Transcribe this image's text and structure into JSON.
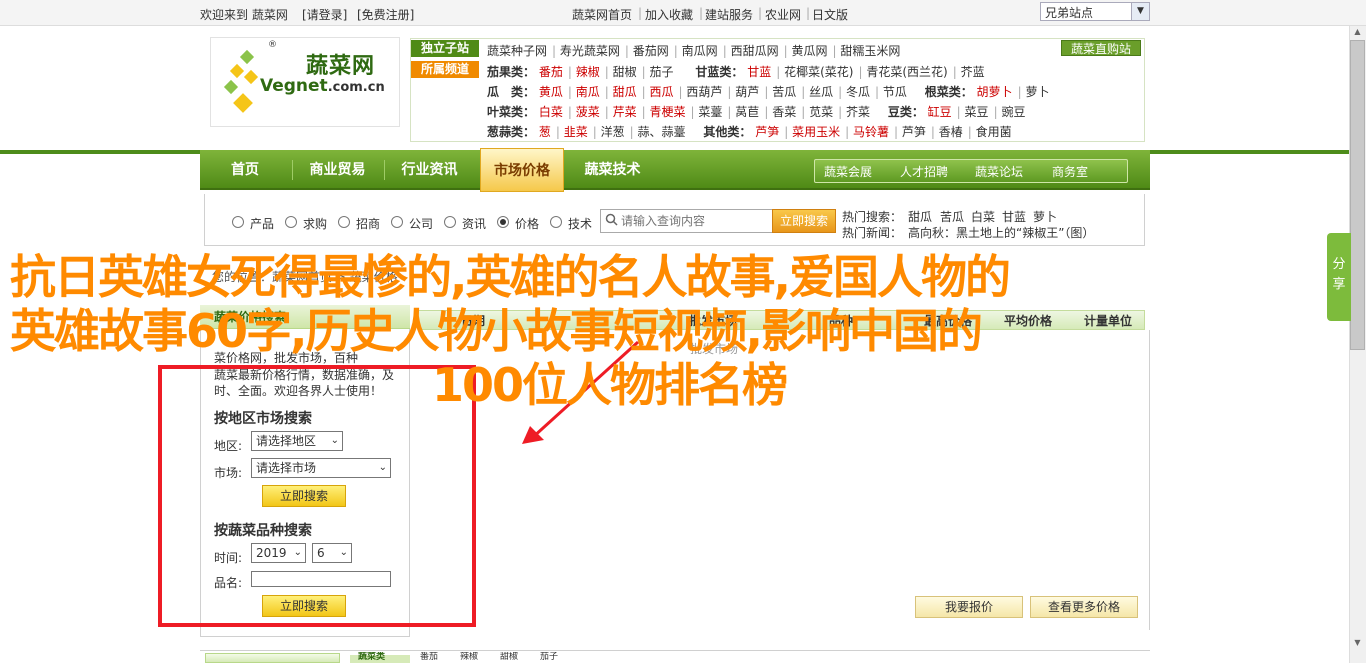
{
  "topbar": {
    "welcome": "欢迎来到 蔬菜网",
    "login": "[请登录]",
    "register": "[免费注册]",
    "links": [
      "蔬菜网首页",
      "加入收藏",
      "建站服务",
      "农业网",
      "日文版"
    ],
    "site_select": "兄弟站点"
  },
  "logo": {
    "cn": "蔬菜网",
    "en_a": "Vegnet",
    "en_b": ".com.cn",
    "reg": "®"
  },
  "category": {
    "tag1": "独立子站",
    "tag2": "所属频道",
    "buy_button": "蔬菜直购站",
    "row0": [
      "蔬菜种子网",
      "寿光蔬菜网",
      "番茄网",
      "南瓜网",
      "西甜瓜网",
      "黄瓜网",
      "甜糯玉米网"
    ],
    "row1_label": "茄果类：",
    "row1": [
      "番茄",
      "辣椒",
      "甜椒",
      "茄子"
    ],
    "row1b_label": "甘蓝类：",
    "row1b": [
      "甘蓝",
      "花椰菜(菜花)",
      "青花菜(西兰花)",
      "芥蓝"
    ],
    "row2_label": "瓜　类：",
    "row2": [
      "黄瓜",
      "南瓜",
      "甜瓜",
      "西瓜",
      "西葫芦",
      "葫芦",
      "苦瓜",
      "丝瓜",
      "冬瓜",
      "节瓜"
    ],
    "row2b_label": "根菜类：",
    "row2b": [
      "胡萝卜",
      "萝卜"
    ],
    "row3_label": "叶菜类：",
    "row3": [
      "白菜",
      "菠菜",
      "芹菜",
      "青梗菜",
      "菜薹",
      "莴苣",
      "香菜",
      "苋菜",
      "芥菜"
    ],
    "row3b_label": "豆类：",
    "row3b": [
      "缸豆",
      "菜豆",
      "豌豆"
    ],
    "row4_label": "葱蒜类：",
    "row4": [
      "葱",
      "韭菜",
      "洋葱",
      "蒜、蒜薹"
    ],
    "row4b_label": "其他类：",
    "row4b": [
      "芦笋",
      "菜用玉米",
      "马铃薯",
      "芦笋",
      "香椿",
      "食用菌"
    ]
  },
  "nav": {
    "items": [
      "首页",
      "商业贸易",
      "行业资讯",
      "市场价格",
      "蔬菜技术"
    ],
    "sub": [
      "蔬菜会展",
      "人才招聘",
      "蔬菜论坛",
      "商务室"
    ]
  },
  "search": {
    "radios": [
      "产品",
      "求购",
      "招商",
      "公司",
      "资讯",
      "价格",
      "技术"
    ],
    "selected": "价格",
    "placeholder": "请输入查询内容",
    "button": "立即搜索",
    "hot_label": "热门搜索：",
    "hot": [
      "甜瓜",
      "苦瓜",
      "白菜",
      "甘蓝",
      "萝卜"
    ],
    "news_label": "热门新闻：",
    "news": "高向秋：黑土地上的“辣椒王”（图）"
  },
  "breadcrumb": "您的位置：蔬菜网首页 > 蔬菜价格",
  "left_panel": {
    "title": "蔬菜价格搜索",
    "intro1": "菜价格网，批发市场，百种",
    "intro2": "蔬菜最新价格行情，数据准确，及",
    "intro3": "时、全面。欢迎各界人士使用！",
    "region_heading": "按地区市场搜索",
    "region_label": "地区:",
    "region_value": "请选择地区",
    "market_label": "市场:",
    "market_value": "请选择市场",
    "search_btn": "立即搜索",
    "variety_heading": "按蔬菜品种搜索",
    "time_label": "时间:",
    "year": "2019",
    "month": "6",
    "name_label": "品名:",
    "search_btn2": "立即搜索"
  },
  "table": {
    "headers": [
      "日期",
      "批发市场",
      "品种",
      "最高价格",
      "平均价格",
      "计量单位"
    ],
    "market_col_hint": "批发市场"
  },
  "actions": {
    "report": "我要报价",
    "more": "查看更多价格"
  },
  "bottom": {
    "tab": "蔬菜类",
    "links": [
      "番茄",
      "辣椒",
      "甜椒",
      "茄子"
    ]
  },
  "share": "分享",
  "overlay": {
    "line1": "抗日英雄女死得最惨的,英雄的名人故事,爱国人物的",
    "line2": "英雄故事60字,历史人物小故事短视频,影响中国的",
    "line3": "100位人物排名榜"
  },
  "colors": {
    "brand_green": "#4d8c1a",
    "overlay_orange": "#ff8a00",
    "annotation_red": "#ee1c25",
    "price_red": "#cc0000"
  }
}
